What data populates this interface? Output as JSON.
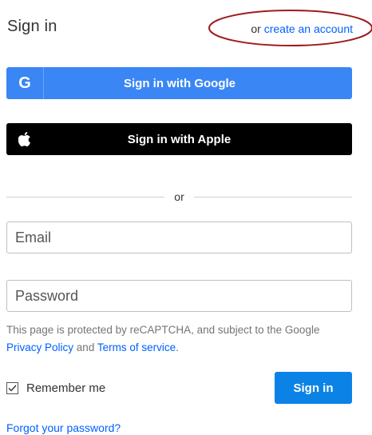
{
  "header": {
    "title": "Sign in",
    "create_prefix": "or",
    "create_link": "create an account"
  },
  "sso": {
    "google_label": "Sign in with Google",
    "google_icon_letter": "G",
    "apple_label": "Sign in with Apple",
    "google_icon": "google-icon",
    "apple_icon": "apple-icon"
  },
  "divider": {
    "text": "or"
  },
  "form": {
    "email_placeholder": "Email",
    "email_value": "",
    "password_placeholder": "Password",
    "password_value": ""
  },
  "recaptcha": {
    "text_before": "This page is protected by reCAPTCHA, and subject to the Google",
    "privacy_link": "Privacy Policy",
    "and": "and",
    "terms_link": "Terms of service",
    "period": "."
  },
  "remember": {
    "label": "Remember me",
    "checked": true
  },
  "signin_button": "Sign in",
  "forgot_link": "Forgot your password?",
  "colors": {
    "google_blue": "#3a86f4",
    "apple_black": "#000000",
    "primary_blue": "#0b83e6",
    "link_blue": "#0061fe",
    "annotation_red": "#a01c1c"
  }
}
